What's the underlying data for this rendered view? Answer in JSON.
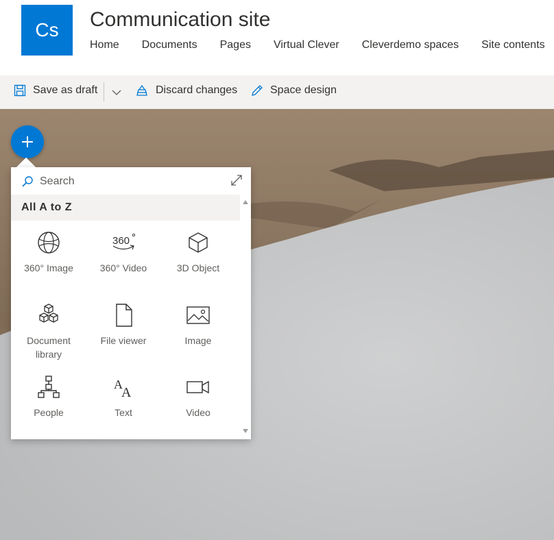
{
  "header": {
    "logo_text": "Cs",
    "site_title": "Communication site",
    "nav": [
      "Home",
      "Documents",
      "Pages",
      "Virtual Clever",
      "Cleverdemo spaces",
      "Site contents"
    ]
  },
  "commandbar": {
    "save_label": "Save as draft",
    "discard_label": "Discard changes",
    "design_label": "Space design"
  },
  "toolbox": {
    "search_placeholder": "Search",
    "section_title": "All A to Z",
    "items": [
      {
        "label": "360° Image",
        "icon": "globe-icon"
      },
      {
        "label": "360° Video",
        "icon": "video-360-icon"
      },
      {
        "label": "3D Object",
        "icon": "cube-icon"
      },
      {
        "label": "Document library",
        "icon": "stacked-cubes-icon"
      },
      {
        "label": "File viewer",
        "icon": "document-icon"
      },
      {
        "label": "Image",
        "icon": "image-icon"
      },
      {
        "label": "People",
        "icon": "org-chart-icon"
      },
      {
        "label": "Text",
        "icon": "font-size-icon"
      },
      {
        "label": "Video",
        "icon": "video-camera-icon"
      }
    ]
  },
  "colors": {
    "brand": "#0078d4",
    "commandbar_bg": "#f3f2f1"
  }
}
